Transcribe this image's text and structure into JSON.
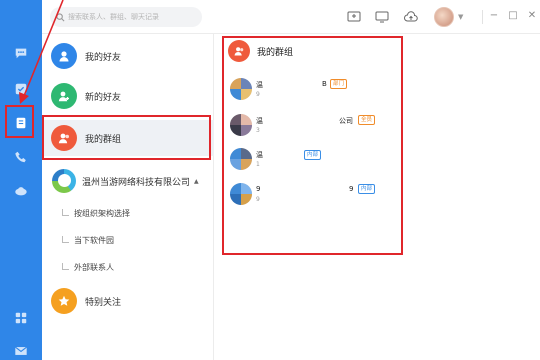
{
  "search": {
    "placeholder": "搜索联系人、群组、聊天记录"
  },
  "contacts": {
    "my_friends": "我的好友",
    "new_friends": "新的好友",
    "my_groups": "我的群组",
    "organization": "温州当游网络科技有限公司",
    "org_caret": "▲",
    "sub_items": [
      "按组织架构选择",
      "当下软件园",
      "外部联系人"
    ],
    "special_follow": "特别关注"
  },
  "right_panel": {
    "title": "我的群组",
    "groups": [
      {
        "name": "温",
        "sub": "9",
        "suffix": "B",
        "tag": "部门",
        "tag_color": "orange"
      },
      {
        "name": "温",
        "sub": "3",
        "suffix": "公司",
        "tag": "全员",
        "tag_color": "orange"
      },
      {
        "name": "温",
        "sub": "1",
        "suffix": "",
        "tag": "内部",
        "tag_color": "blue"
      },
      {
        "name": "9",
        "sub": "9",
        "suffix": "9",
        "tag": "内部",
        "tag_color": "blue"
      }
    ]
  },
  "colors": {
    "rail": "#2f86e8",
    "friends_icon": "#2f86e8",
    "new_friends_icon": "#2eb872",
    "groups_icon": "#ef5a3c",
    "special_icon": "#f5a020",
    "annotation": "#e0262b"
  },
  "icons": {
    "rail": [
      "chat-icon",
      "apps-icon",
      "contacts-icon",
      "phone-icon",
      "cloud-icon",
      "grid-icon",
      "mail-icon"
    ],
    "topbar": [
      "screen-share-icon",
      "monitor-icon",
      "cloud-upload-icon"
    ]
  }
}
